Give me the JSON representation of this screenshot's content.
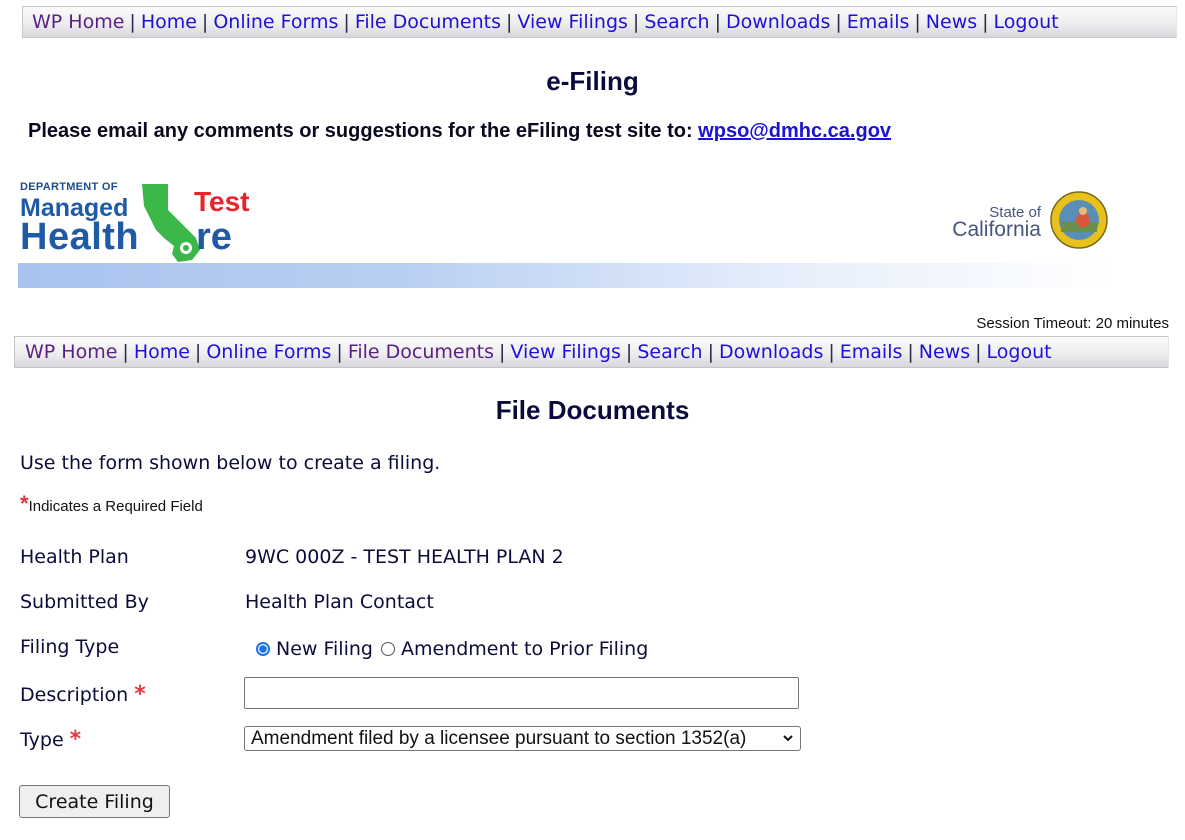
{
  "nav": {
    "items": [
      {
        "label": "WP Home",
        "visited": true
      },
      {
        "label": "Home",
        "visited": false
      },
      {
        "label": "Online Forms",
        "visited": false
      },
      {
        "label": "File Documents",
        "visited": false
      },
      {
        "label": "View Filings",
        "visited": false
      },
      {
        "label": "Search",
        "visited": false
      },
      {
        "label": "Downloads",
        "visited": false
      },
      {
        "label": "Emails",
        "visited": false
      },
      {
        "label": "News",
        "visited": false
      },
      {
        "label": "Logout",
        "visited": false
      }
    ],
    "separator": "|",
    "link_color": "#1f10d8",
    "visited_color": "#5b2182"
  },
  "nav_bottom": {
    "items": [
      {
        "label": "WP Home",
        "visited": true
      },
      {
        "label": "Home",
        "visited": false
      },
      {
        "label": "Online Forms",
        "visited": false
      },
      {
        "label": "File Documents",
        "visited": true
      },
      {
        "label": "View Filings",
        "visited": false
      },
      {
        "label": "Search",
        "visited": false
      },
      {
        "label": "Downloads",
        "visited": false
      },
      {
        "label": "Emails",
        "visited": false
      },
      {
        "label": "News",
        "visited": false
      },
      {
        "label": "Logout",
        "visited": false
      }
    ]
  },
  "header": {
    "site_title": "e-Filing",
    "comment_text": "Please email any comments or suggestions for the eFiling test site to: ",
    "comment_email": "wpso@dmhc.ca.gov"
  },
  "banner": {
    "dept_line": "DEPARTMENT OF",
    "managed": "Managed",
    "health": "Health",
    "care_suffix": "re",
    "test_badge": "Test",
    "state_of": "State of",
    "california": "California",
    "seal_icon": "california-state-seal"
  },
  "session": {
    "timeout_text": "Session Timeout: 20 minutes"
  },
  "page": {
    "title": "File Documents",
    "intro": "Use the form shown below to create a filing.",
    "required_star": "*",
    "required_note": "Indicates a Required Field"
  },
  "form": {
    "health_plan_label": "Health Plan",
    "health_plan_value": "9WC 000Z - TEST HEALTH PLAN 2",
    "submitted_by_label": "Submitted By",
    "submitted_by_value": "Health Plan Contact",
    "filing_type_label": "Filing Type",
    "filing_type_options": [
      {
        "label": "New Filing",
        "selected": true
      },
      {
        "label": "Amendment to Prior Filing",
        "selected": false
      }
    ],
    "description_label": "Description",
    "description_value": "",
    "description_placeholder": "",
    "type_label": "Type",
    "type_selected": "Amendment filed by a licensee pursuant to section 1352(a)",
    "required_star": "*",
    "submit_label": "Create Filing"
  }
}
